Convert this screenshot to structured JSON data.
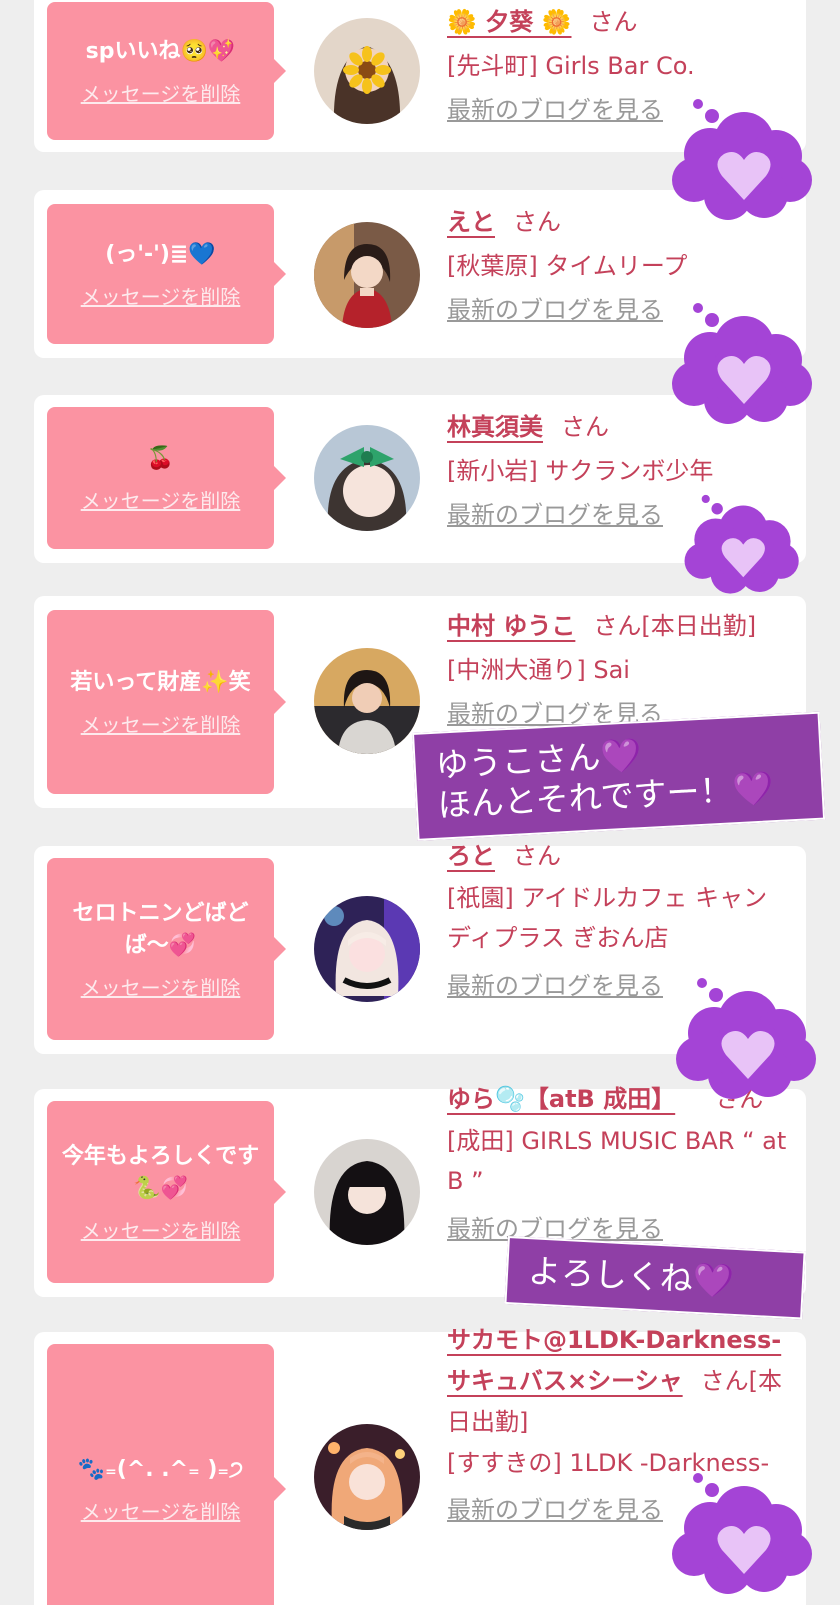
{
  "colors": {
    "bubble": "#fb93a2",
    "accent": "#c4415a",
    "link_gray": "#999999",
    "sticker_purple": "#8f3fa6",
    "background": "#eeeeee"
  },
  "common": {
    "delete_label": "メッセージを削除",
    "blog_label": "最新のブログを見る",
    "san_label": "さん"
  },
  "cards": [
    {
      "message": "spいいね🥺💖",
      "name": "🌼 夕葵 🌼",
      "shop": "[先斗町] Girls Bar Co.",
      "avatar_icon": "sunflower-face-avatar"
    },
    {
      "message": "(っ'-')≣💙",
      "name": "えと",
      "shop": "[秋葉原] タイムリープ",
      "avatar_icon": "idol-red-dress-avatar"
    },
    {
      "message": "🍒",
      "name": "林真須美",
      "shop": "[新小岩] サクランボ少年",
      "avatar_icon": "green-bow-avatar"
    },
    {
      "message": "若いって財産✨笑",
      "name": "中村 ゆうこ",
      "suffix": "[本日出勤]",
      "shop": "[中洲大通り] Sai",
      "avatar_icon": "woman-sofa-avatar"
    },
    {
      "message": "セロトニンどばどば〜💞",
      "name": "ろと",
      "shop": "[祇園] アイドルカフェ キャンディプラス ぎおん店",
      "avatar_icon": "blonde-neon-avatar"
    },
    {
      "message": "今年もよろしくです🐍💞",
      "name": "ゆら🫧【atB 成田】",
      "shop": "[成田] GIRLS MUSIC BAR “ at B ”",
      "avatar_icon": "dark-hair-avatar"
    },
    {
      "message": "🐾₌(^. .^₌ )₌੭",
      "name": "サカモト@1LDK-Darkness-サキュバス×シーシャ",
      "suffix": "[本日出勤]",
      "shop": "[すすきの] 1LDK -Darkness-",
      "avatar_icon": "pink-hair-avatar"
    }
  ],
  "stickers": [
    {
      "line1": "ゆうこさん💜",
      "line2": "ほんとそれですー！💜"
    },
    {
      "line1": "よろしくね💜"
    }
  ],
  "decor_icons": [
    "heart-cloud-icon"
  ]
}
